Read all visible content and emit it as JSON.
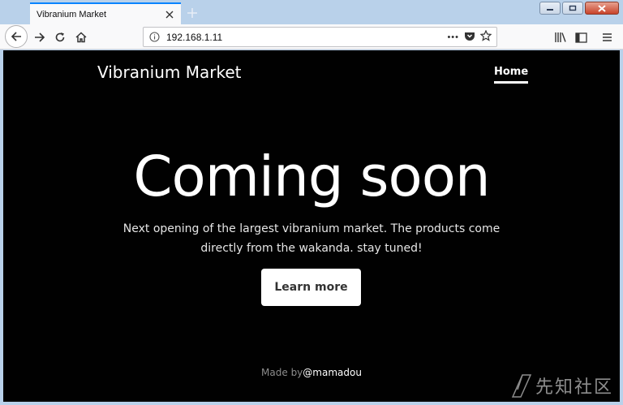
{
  "browser": {
    "tab_title": "Vibranium Market",
    "url": "192.168.1.11",
    "url_more": "•••"
  },
  "page": {
    "brand": "Vibranium Market",
    "nav_home": "Home",
    "hero_title": "Coming soon",
    "hero_text": "Next opening of the largest vibranium market. The products come directly from the wakanda. stay tuned!",
    "cta_label": "Learn more",
    "footer_prefix": "Made by",
    "footer_author": "@mamadou"
  },
  "watermark": {
    "text": "先知社区"
  },
  "colors": {
    "accent": "#0a84ff",
    "page_bg": "#010101",
    "frame": "#b9d1ea"
  }
}
